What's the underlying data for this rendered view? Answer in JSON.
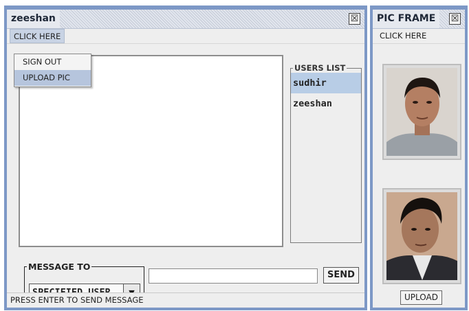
{
  "chat_window": {
    "title": "zeeshan",
    "menu_label": "CLICK HERE",
    "dropdown": [
      "SIGN OUT",
      "UPLOAD PIC"
    ],
    "dropdown_highlight": 1,
    "users_list_label": "USERS LIST",
    "users": [
      "sudhir",
      "zeeshan"
    ],
    "selected_user": "sudhir",
    "message_to_label": "MESSAGE TO",
    "message_to_value": "SPECIFIED USER",
    "message_input_value": "",
    "send_label": "SEND",
    "status_text": "PRESS ENTER TO SEND MESSAGE",
    "close_glyph": "☒"
  },
  "pic_window": {
    "title": "PIC FRAME",
    "menu_label": "CLICK HERE",
    "upload_label": "UPLOAD",
    "close_glyph": "☒"
  },
  "colors": {
    "window_border": "#7d98c6",
    "selection": "#b8cde6",
    "menu_highlight": "#b6c5dd"
  },
  "icons": [
    "close-icon",
    "chevron-down-icon",
    "user-photo"
  ]
}
